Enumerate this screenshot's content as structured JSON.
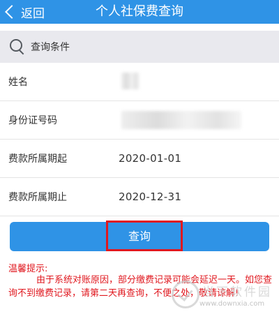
{
  "header": {
    "back_label": "返回",
    "title": "个人社保费查询",
    "background_color": "#2f93e6"
  },
  "search_conditions": {
    "label": "查询条件",
    "icon": "search-icon"
  },
  "form": {
    "name": {
      "label": "姓名",
      "value_obscured": true
    },
    "id_number": {
      "label": "身份证号码",
      "value_obscured": true
    },
    "period_start": {
      "label": "费款所属期起",
      "value": "2020-01-01"
    },
    "period_end": {
      "label": "费款所属期止",
      "value": "2020-12-31"
    }
  },
  "query_button": {
    "label": "查询",
    "highlight_color": "#e0181f"
  },
  "tip": {
    "title": "温馨提示:",
    "body": "由于系统对账原因，部分缴费记录可能会延迟一天。如您查询不到缴费记录，请第二天再查询，不便之处，敬请谅解!",
    "color": "#e0181f"
  },
  "watermark": {
    "text": "当下软件园",
    "url": "www.downxia.com"
  }
}
